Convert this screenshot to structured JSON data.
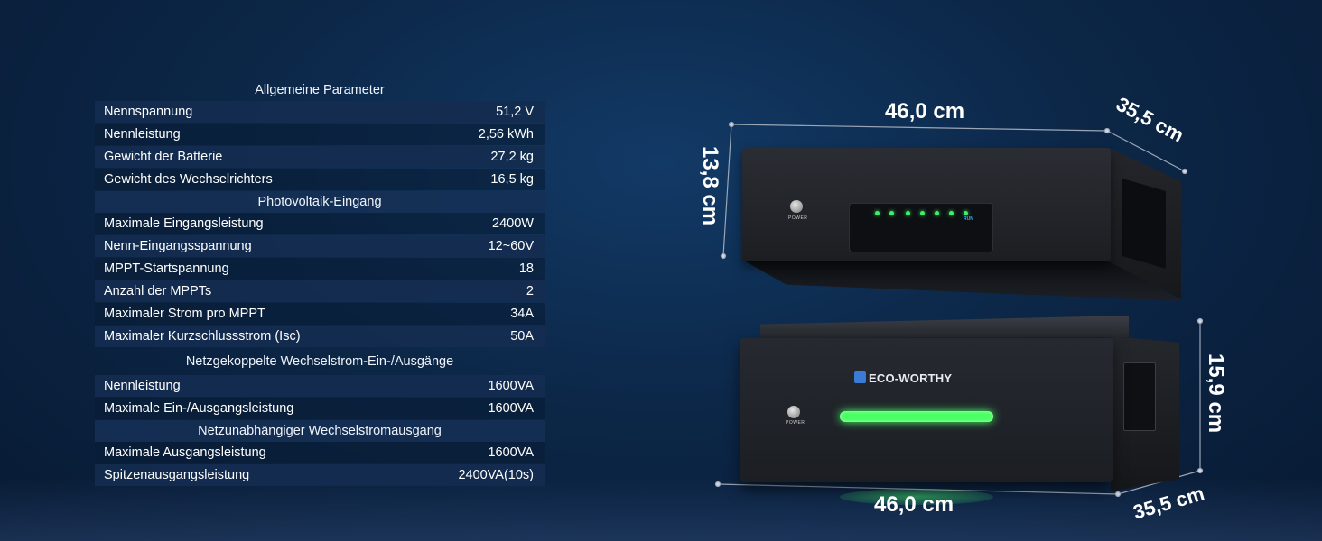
{
  "spec_table": {
    "sections": [
      {
        "title": "Allgemeine Parameter",
        "rows": [
          {
            "label": "Nennspannung",
            "value": "51,2 V"
          },
          {
            "label": "Nennleistung",
            "value": "2,56 kWh"
          },
          {
            "label": "Gewicht der Batterie",
            "value": "27,2 kg"
          },
          {
            "label": "Gewicht des Wechselrichters",
            "value": "16,5 kg"
          }
        ]
      },
      {
        "title": "Photovoltaik-Eingang",
        "rows": [
          {
            "label": "Maximale Eingangsleistung",
            "value": "2400W"
          },
          {
            "label": "Nenn-Eingangsspannung",
            "value": "12~60V"
          },
          {
            "label": "MPPT-Startspannung",
            "value": "18"
          },
          {
            "label": "Anzahl der MPPTs",
            "value": "2"
          },
          {
            "label": "Maximaler Strom pro MPPT",
            "value": "34A"
          },
          {
            "label": "Maximaler Kurzschlussstrom (Isc)",
            "value": "50A"
          }
        ]
      },
      {
        "title": "Netzgekoppelte Wechselstrom-Ein-/Ausgänge",
        "rows": [
          {
            "label": "Nennleistung",
            "value": "1600VA"
          },
          {
            "label": "Maximale Ein-/Ausgangsleistung",
            "value": "1600VA"
          }
        ]
      },
      {
        "title": "Netzunabhängiger Wechselstromausgang",
        "rows": [
          {
            "label": "Maximale Ausgangsleistung",
            "value": "1600VA"
          },
          {
            "label": "Spitzenausgangsleistung",
            "value": "2400VA(10s)"
          }
        ]
      }
    ]
  },
  "dimensions": {
    "inverter_width": "46,0 cm",
    "inverter_depth": "35,5 cm",
    "inverter_height": "13,8 cm",
    "battery_width": "46,0 cm",
    "battery_depth": "35,5 cm",
    "battery_height": "15,9 cm"
  },
  "device_labels": {
    "power": "POWER",
    "run": "RUN",
    "brand": "ECO-WORTHY"
  },
  "colors": {
    "background": "#0c2748",
    "led_green": "#3cf06a",
    "run_blue": "#3aa8ff"
  }
}
